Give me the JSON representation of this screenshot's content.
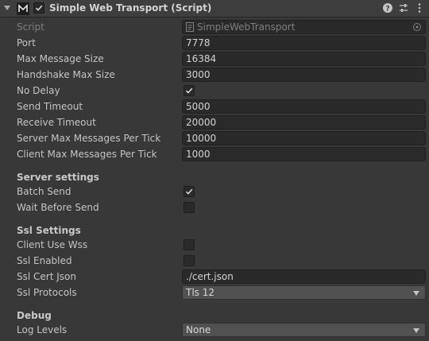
{
  "header": {
    "title": "Simple Web Transport (Script)",
    "enabled": true,
    "fold_icon": "foldout-arrow-icon",
    "logo_icon": "mirror-logo-icon",
    "help_icon": "help-icon",
    "presets_icon": "presets-icon",
    "menu_icon": "kebab-menu-icon"
  },
  "script": {
    "label": "Script",
    "value": "SimpleWebTransport"
  },
  "fields": {
    "port": {
      "label": "Port",
      "value": "7778"
    },
    "max_message_size": {
      "label": "Max Message Size",
      "value": "16384"
    },
    "handshake_max_size": {
      "label": "Handshake Max Size",
      "value": "3000"
    },
    "no_delay": {
      "label": "No Delay",
      "checked": true
    },
    "send_timeout": {
      "label": "Send Timeout",
      "value": "5000"
    },
    "receive_timeout": {
      "label": "Receive Timeout",
      "value": "20000"
    },
    "server_max_messages": {
      "label": "Server Max Messages Per Tick",
      "value": "10000"
    },
    "client_max_messages": {
      "label": "Client Max Messages Per Tick",
      "value": "1000"
    }
  },
  "server_settings": {
    "title": "Server settings",
    "batch_send": {
      "label": "Batch Send",
      "checked": true
    },
    "wait_before_send": {
      "label": "Wait Before Send",
      "checked": false
    }
  },
  "ssl_settings": {
    "title": "Ssl Settings",
    "client_use_wss": {
      "label": "Client Use Wss",
      "checked": false
    },
    "ssl_enabled": {
      "label": "Ssl Enabled",
      "checked": false
    },
    "ssl_cert_json": {
      "label": "Ssl Cert Json",
      "value": "./cert.json"
    },
    "ssl_protocols": {
      "label": "Ssl Protocols",
      "value": "Tls 12"
    }
  },
  "debug": {
    "title": "Debug",
    "log_levels": {
      "label": "Log Levels",
      "value": "None"
    }
  },
  "colors": {
    "background": "#383838",
    "header": "#3e3e3e",
    "field": "#2a2a2a",
    "dropdown": "#515151",
    "text": "#c4c4c4"
  }
}
